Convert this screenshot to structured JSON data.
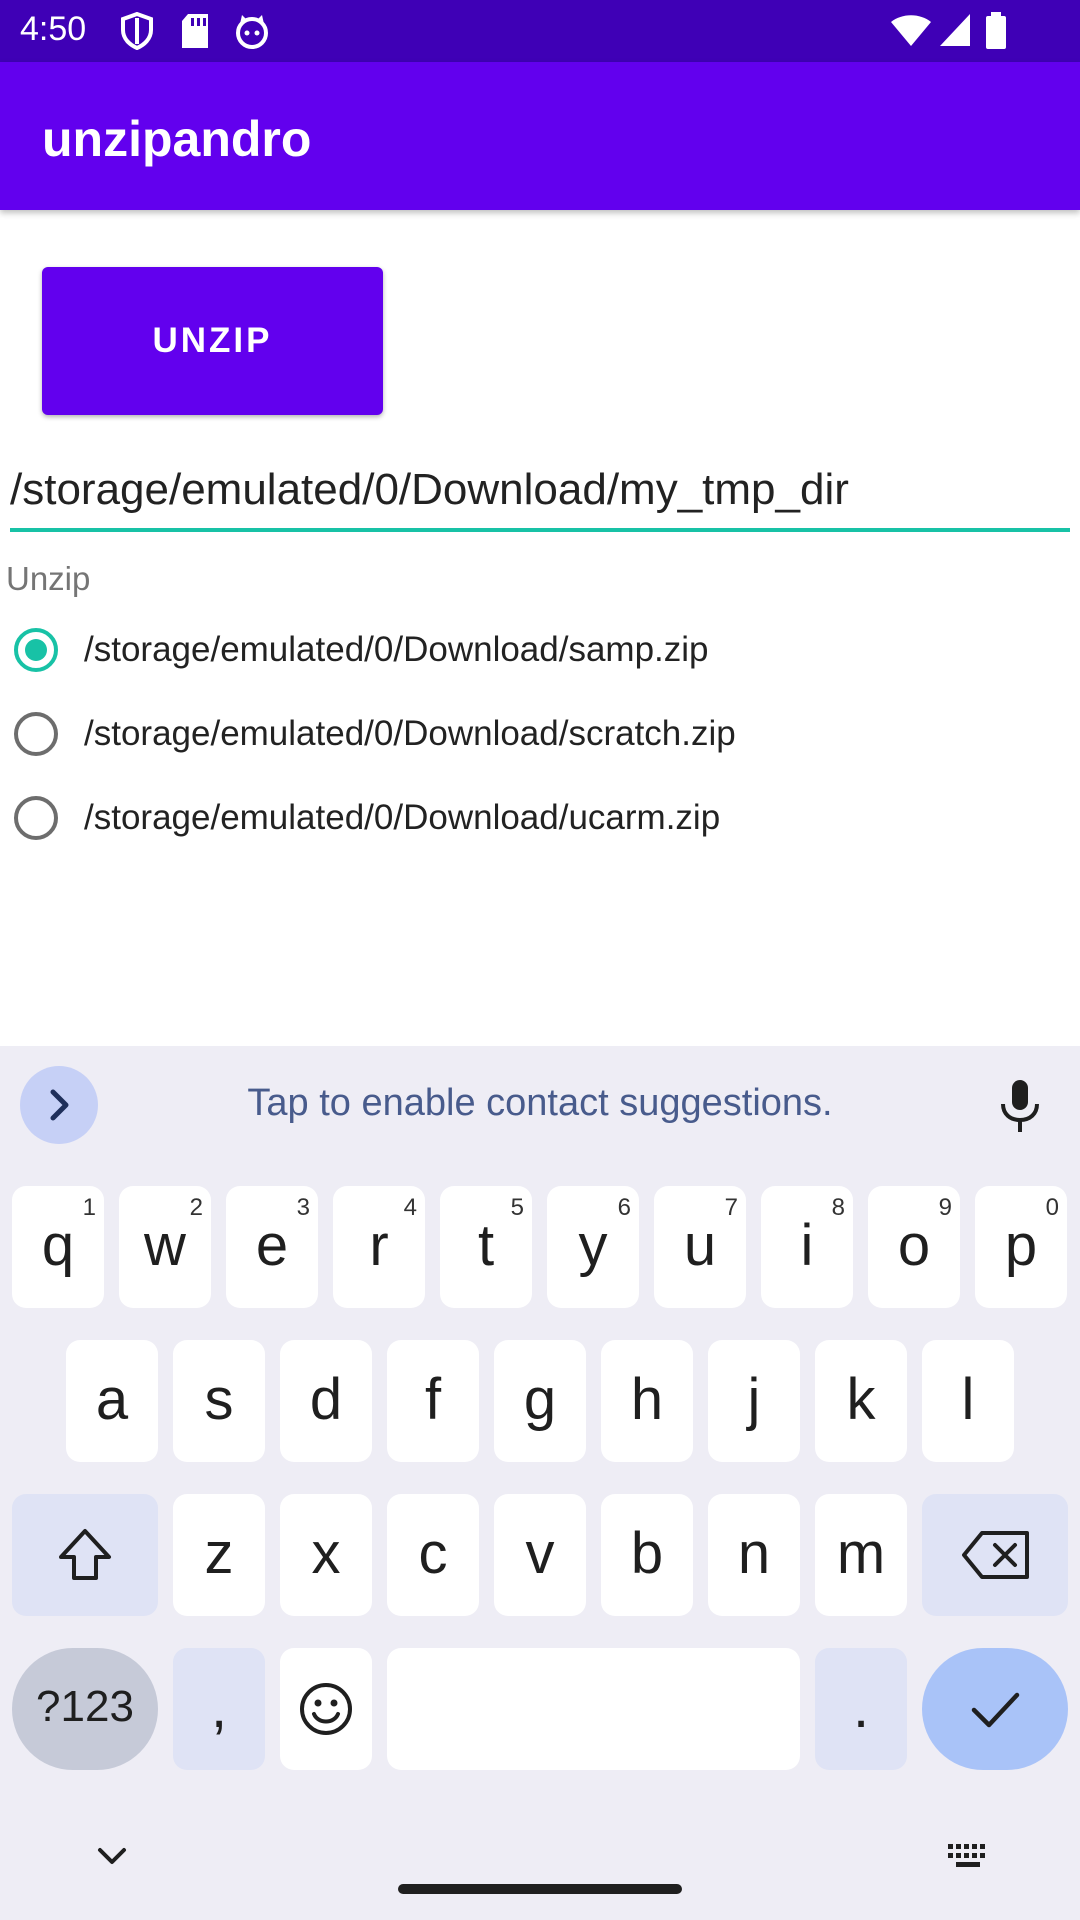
{
  "status_bar": {
    "time": "4:50"
  },
  "app_bar": {
    "title": "unzipandro"
  },
  "main": {
    "unzip_button_label": "UNZIP",
    "path_value": "/storage/emulated/0/Download/my_tmp_dir",
    "radio_group_label": "Unzip",
    "radio_options": [
      {
        "label": "/storage/emulated/0/Download/samp.zip",
        "checked": true
      },
      {
        "label": "/storage/emulated/0/Download/scratch.zip",
        "checked": false
      },
      {
        "label": "/storage/emulated/0/Download/ucarm.zip",
        "checked": false
      }
    ]
  },
  "keyboard": {
    "suggestion_text": "Tap to enable contact suggestions.",
    "row1": [
      {
        "key": "q",
        "hint": "1"
      },
      {
        "key": "w",
        "hint": "2"
      },
      {
        "key": "e",
        "hint": "3"
      },
      {
        "key": "r",
        "hint": "4"
      },
      {
        "key": "t",
        "hint": "5"
      },
      {
        "key": "y",
        "hint": "6"
      },
      {
        "key": "u",
        "hint": "7"
      },
      {
        "key": "i",
        "hint": "8"
      },
      {
        "key": "o",
        "hint": "9"
      },
      {
        "key": "p",
        "hint": "0"
      }
    ],
    "row2": [
      "a",
      "s",
      "d",
      "f",
      "g",
      "h",
      "j",
      "k",
      "l"
    ],
    "row3": [
      "z",
      "x",
      "c",
      "v",
      "b",
      "n",
      "m"
    ],
    "symbols_label": "?123",
    "comma_label": ",",
    "period_label": ".",
    "icons": [
      "chevron-right-icon",
      "mic-icon",
      "shift-icon",
      "backspace-icon",
      "emoji-icon",
      "check-icon",
      "chevron-down-icon",
      "keyboard-icon"
    ]
  },
  "colors": {
    "primary": "#6200ee",
    "primary_dark": "#3f00b6",
    "accent": "#18c2a6"
  }
}
